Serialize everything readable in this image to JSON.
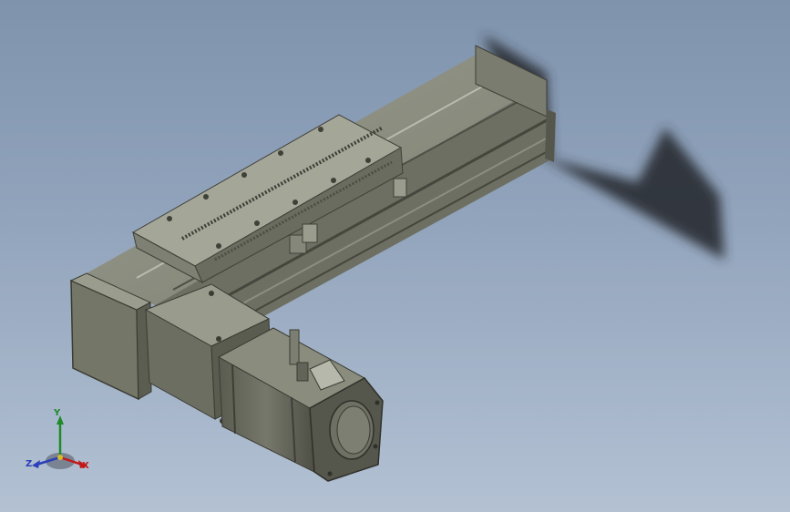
{
  "viewport": {
    "background_top": "#7f93ad",
    "background_bottom": "#b3c1d3"
  },
  "model": {
    "description_icon": "linear-actuator-with-servo-motor-model",
    "body_color": "#6f7163",
    "body_dark": "#4d4e44",
    "body_light": "#8f9182",
    "rail_color": "#9a9c90",
    "shadow_color": "#2b2f36"
  },
  "triad": {
    "x_label": "X",
    "y_label": "Y",
    "z_label": "Z",
    "x_color": "#c21818",
    "y_color": "#1f8a2a",
    "z_color": "#2a3fb8"
  }
}
